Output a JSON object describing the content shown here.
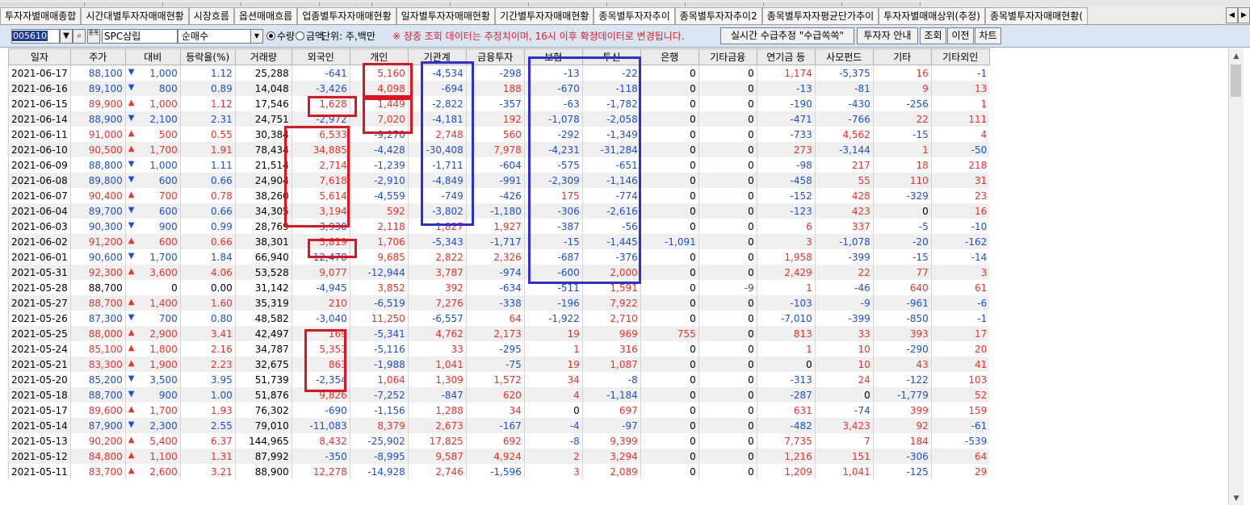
{
  "window": {
    "top_tab_count": 12
  },
  "tabs": [
    {
      "label": "투자자별매매종합",
      "active": false
    },
    {
      "label": "시간대별투자자매매현황",
      "active": false
    },
    {
      "label": "시장흐름",
      "active": false
    },
    {
      "label": "옵션매매흐름",
      "active": false
    },
    {
      "label": "업종별투자자매매현황",
      "active": false
    },
    {
      "label": "일자별투자자매매현황",
      "active": false
    },
    {
      "label": "기간별투자자매매현황",
      "active": false
    },
    {
      "label": "종목별투자자추이",
      "active": true
    },
    {
      "label": "종목별투자자추이2",
      "active": false
    },
    {
      "label": "종목별투자자평균단가추이",
      "active": false
    },
    {
      "label": "투자자별매매상위(추정)",
      "active": false
    },
    {
      "label": "종목별투자자매매현황(",
      "active": false
    }
  ],
  "tab_nav": {
    "prev": "◀",
    "next": "▶"
  },
  "toolbar": {
    "code": "005610",
    "search_icon": "⌕",
    "stock_icon_label": "종목",
    "stock_name": "SPC삼립",
    "select_value": "순매수",
    "select_arrow": "▼",
    "radio_qty": "수량",
    "radio_amt": "금액",
    "radio_selected": "qty",
    "unit": "단위: 주,백만",
    "notice": "※ 장중 조회 데이터는 추정치이며, 16시 이후 확정데이터로 변경됩니다.",
    "realtime_button": "실시간 수급추정 \"수급쏙쏙\"",
    "investor_guide_button": "투자자 안내",
    "query_button": "조회",
    "prev_button": "이전",
    "chart_button": "차트"
  },
  "colors": {
    "up": "#e8332d",
    "down": "#1f4fd0",
    "highlight_red": "#e0141e",
    "highlight_blue": "#2d2fd6"
  },
  "table": {
    "headers": [
      "일자",
      "주가",
      "대비",
      "등락율(%)",
      "거래량",
      "외국인",
      "개인",
      "기관계",
      "금융투자",
      "보험",
      "투신",
      "은행",
      "기타금융",
      "연기금 등",
      "사모펀드",
      "기타",
      "기타외인"
    ],
    "rows": [
      [
        "2021-06-17",
        "88,100",
        "▼",
        "1,000",
        "1.12",
        "25,288",
        "-641",
        "5,160",
        "-4,534",
        "-298",
        "-13",
        "-22",
        "0",
        "0",
        "1,174",
        "-5,375",
        "16",
        "-1"
      ],
      [
        "2021-06-16",
        "89,100",
        "▼",
        "800",
        "0.89",
        "14,048",
        "-3,426",
        "4,098",
        "-694",
        "188",
        "-670",
        "-118",
        "0",
        "0",
        "-13",
        "-81",
        "9",
        "13"
      ],
      [
        "2021-06-15",
        "89,900",
        "▲",
        "1,000",
        "1.12",
        "17,546",
        "1,628",
        "1,449",
        "-2,822",
        "-357",
        "-63",
        "-1,782",
        "0",
        "0",
        "-190",
        "-430",
        "-256",
        "1"
      ],
      [
        "2021-06-14",
        "88,900",
        "▼",
        "2,100",
        "2.31",
        "24,751",
        "-2,972",
        "7,020",
        "-4,181",
        "192",
        "-1,078",
        "-2,058",
        "0",
        "0",
        "-471",
        "-766",
        "22",
        "111"
      ],
      [
        "2021-06-11",
        "91,000",
        "▲",
        "500",
        "0.55",
        "30,384",
        "6,533",
        "-9,270",
        "2,748",
        "560",
        "-292",
        "-1,349",
        "0",
        "0",
        "-733",
        "4,562",
        "-15",
        "4"
      ],
      [
        "2021-06-10",
        "90,500",
        "▲",
        "1,700",
        "1.91",
        "78,434",
        "34,885",
        "-4,428",
        "-30,408",
        "7,978",
        "-4,231",
        "-31,284",
        "0",
        "0",
        "273",
        "-3,144",
        "1",
        "-50"
      ],
      [
        "2021-06-09",
        "88,800",
        "▼",
        "1,000",
        "1.11",
        "21,514",
        "2,714",
        "-1,239",
        "-1,711",
        "-604",
        "-575",
        "-651",
        "0",
        "0",
        "-98",
        "217",
        "18",
        "218"
      ],
      [
        "2021-06-08",
        "89,800",
        "▼",
        "600",
        "0.66",
        "24,904",
        "7,618",
        "-2,910",
        "-4,849",
        "-991",
        "-2,309",
        "-1,146",
        "0",
        "0",
        "-458",
        "55",
        "110",
        "31"
      ],
      [
        "2021-06-07",
        "90,400",
        "▲",
        "700",
        "0.78",
        "38,260",
        "5,614",
        "-4,559",
        "-749",
        "-426",
        "175",
        "-774",
        "0",
        "0",
        "-152",
        "428",
        "-329",
        "23"
      ],
      [
        "2021-06-04",
        "89,700",
        "▼",
        "600",
        "0.66",
        "34,305",
        "3,194",
        "592",
        "-3,802",
        "-1,180",
        "-306",
        "-2,616",
        "0",
        "0",
        "-123",
        "423",
        "0",
        "16"
      ],
      [
        "2021-06-03",
        "90,300",
        "▼",
        "900",
        "0.99",
        "28,769",
        "-3,930",
        "2,118",
        "1,827",
        "1,927",
        "-387",
        "-56",
        "0",
        "0",
        "6",
        "337",
        "-5",
        "-10"
      ],
      [
        "2021-06-02",
        "91,200",
        "▲",
        "600",
        "0.66",
        "38,301",
        "3,819",
        "1,706",
        "-5,343",
        "-1,717",
        "-15",
        "-1,445",
        "-1,091",
        "0",
        "3",
        "-1,078",
        "-20",
        "-162"
      ],
      [
        "2021-06-01",
        "90,600",
        "▼",
        "1,700",
        "1.84",
        "66,940",
        "-12,478",
        "9,685",
        "2,822",
        "2,326",
        "-687",
        "-376",
        "0",
        "0",
        "1,958",
        "-399",
        "-15",
        "-14"
      ],
      [
        "2021-05-31",
        "92,300",
        "▲",
        "3,600",
        "4.06",
        "53,528",
        "9,077",
        "-12,944",
        "3,787",
        "-974",
        "-600",
        "2,000",
        "0",
        "0",
        "2,429",
        "22",
        "77",
        "3"
      ],
      [
        "2021-05-28",
        "88,700",
        "",
        "0",
        "0.00",
        "31,142",
        "-4,945",
        "3,852",
        "392",
        "-634",
        "-511",
        "1,591",
        "0",
        "-9",
        "1",
        "-46",
        "640",
        "61"
      ],
      [
        "2021-05-27",
        "88,700",
        "▲",
        "1,400",
        "1.60",
        "35,319",
        "210",
        "-6,519",
        "7,276",
        "-338",
        "-196",
        "7,922",
        "0",
        "0",
        "-103",
        "-9",
        "-961",
        "-6"
      ],
      [
        "2021-05-26",
        "87,300",
        "▼",
        "700",
        "0.80",
        "48,582",
        "-3,040",
        "11,250",
        "-6,557",
        "64",
        "-1,922",
        "2,710",
        "0",
        "0",
        "-7,010",
        "-399",
        "-850",
        "-1"
      ],
      [
        "2021-05-25",
        "88,000",
        "▲",
        "2,900",
        "3.41",
        "42,497",
        "169",
        "-5,341",
        "4,762",
        "2,173",
        "19",
        "969",
        "755",
        "0",
        "813",
        "33",
        "393",
        "17"
      ],
      [
        "2021-05-24",
        "85,100",
        "▲",
        "1,800",
        "2.16",
        "34,787",
        "5,353",
        "-5,116",
        "33",
        "-295",
        "1",
        "316",
        "0",
        "0",
        "1",
        "10",
        "-290",
        "20"
      ],
      [
        "2021-05-21",
        "83,300",
        "▲",
        "1,900",
        "2.23",
        "32,675",
        "863",
        "-1,988",
        "1,041",
        "-75",
        "19",
        "1,087",
        "0",
        "0",
        "0",
        "10",
        "43",
        "41"
      ],
      [
        "2021-05-20",
        "85,200",
        "▼",
        "3,500",
        "3.95",
        "51,739",
        "-2,354",
        "1,064",
        "1,309",
        "1,572",
        "34",
        "-8",
        "0",
        "0",
        "-313",
        "24",
        "-122",
        "103"
      ],
      [
        "2021-05-18",
        "88,700",
        "▼",
        "900",
        "1.00",
        "51,876",
        "9,826",
        "-7,252",
        "-847",
        "620",
        "4",
        "-1,184",
        "0",
        "0",
        "-287",
        "0",
        "-1,779",
        "52"
      ],
      [
        "2021-05-17",
        "89,600",
        "▲",
        "1,700",
        "1.93",
        "76,302",
        "-690",
        "-1,156",
        "1,288",
        "34",
        "0",
        "697",
        "0",
        "0",
        "631",
        "-74",
        "399",
        "159"
      ],
      [
        "2021-05-14",
        "87,900",
        "▼",
        "2,300",
        "2.55",
        "79,010",
        "-11,083",
        "8,379",
        "2,673",
        "-167",
        "-4",
        "-97",
        "0",
        "0",
        "-482",
        "3,423",
        "92",
        "-61"
      ],
      [
        "2021-05-13",
        "90,200",
        "▲",
        "5,400",
        "6.37",
        "144,965",
        "8,432",
        "-25,902",
        "17,825",
        "692",
        "-8",
        "9,399",
        "0",
        "0",
        "7,735",
        "7",
        "184",
        "-539"
      ],
      [
        "2021-05-12",
        "84,800",
        "▲",
        "1,100",
        "1.31",
        "87,992",
        "-350",
        "-8,995",
        "9,587",
        "4,924",
        "2",
        "3,294",
        "0",
        "0",
        "1,216",
        "151",
        "-306",
        "64"
      ],
      [
        "2021-05-11",
        "83,700",
        "▲",
        "2,600",
        "3.21",
        "88,900",
        "12,278",
        "-14,928",
        "2,746",
        "-1,596",
        "3",
        "2,089",
        "0",
        "0",
        "1,209",
        "1,041",
        "-125",
        "29"
      ]
    ]
  },
  "scrollbar": {
    "up": "▲",
    "down": "▼"
  }
}
